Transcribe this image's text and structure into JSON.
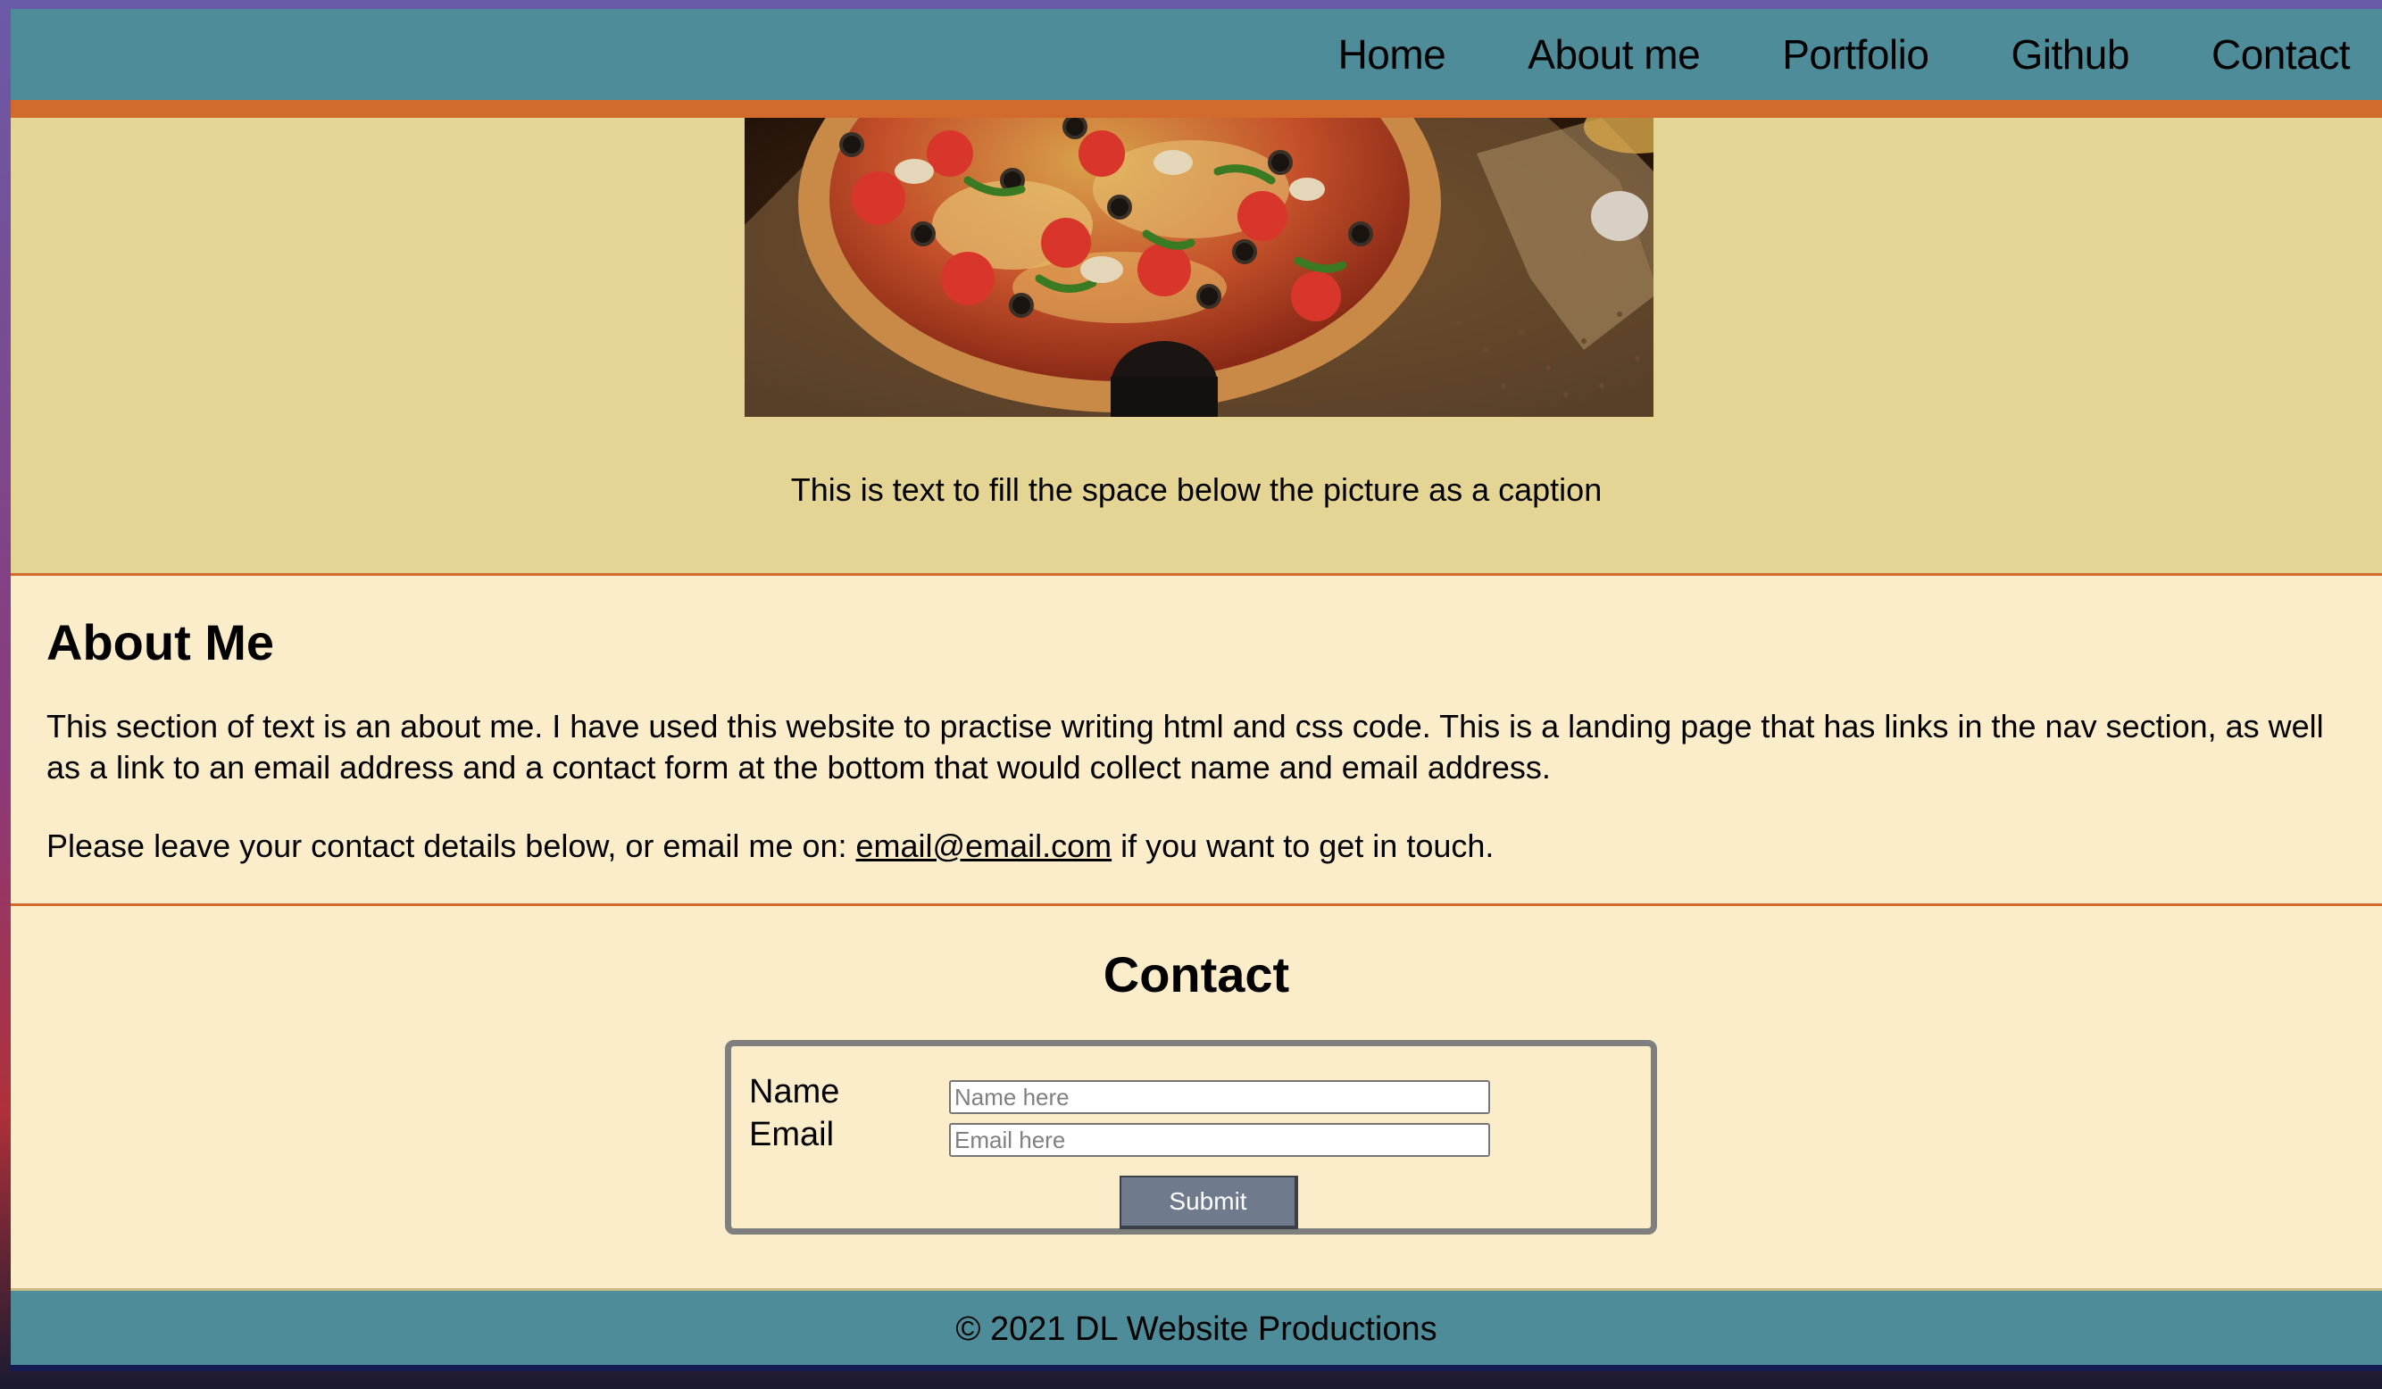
{
  "nav": {
    "links": [
      "Home",
      "About me",
      "Portfolio",
      "Github",
      "Contact"
    ]
  },
  "hero": {
    "image_alt": "pizza-photo",
    "caption": "This is text to fill the space below the picture as a caption"
  },
  "about": {
    "heading": "About Me",
    "paragraph_1": "This section of text is an about me. I have used this website to practise writing html and css code. This is a landing page that has links in the nav section, as well as a link to an email address and a contact form at the bottom that would collect name and email address.",
    "paragraph_2_before": "Please leave your contact details below, or email me on: ",
    "email": "email@email.com",
    "paragraph_2_after": " if you want to get in touch."
  },
  "contact": {
    "heading": "Contact",
    "name_label": "Name",
    "name_placeholder": "Name here",
    "name_value": "",
    "email_label": "Email",
    "email_placeholder": "Email here",
    "email_value": "",
    "submit_label": "Submit"
  },
  "footer": {
    "text": "© 2021 DL Website Productions"
  },
  "colors": {
    "nav_bg": "#4e8c99",
    "accent_stripe": "#d2692d",
    "hero_bg": "#e5d594",
    "page_bg": "#fbecca",
    "submit_bg": "#6f7a8c",
    "form_border": "#7f7f7f"
  }
}
